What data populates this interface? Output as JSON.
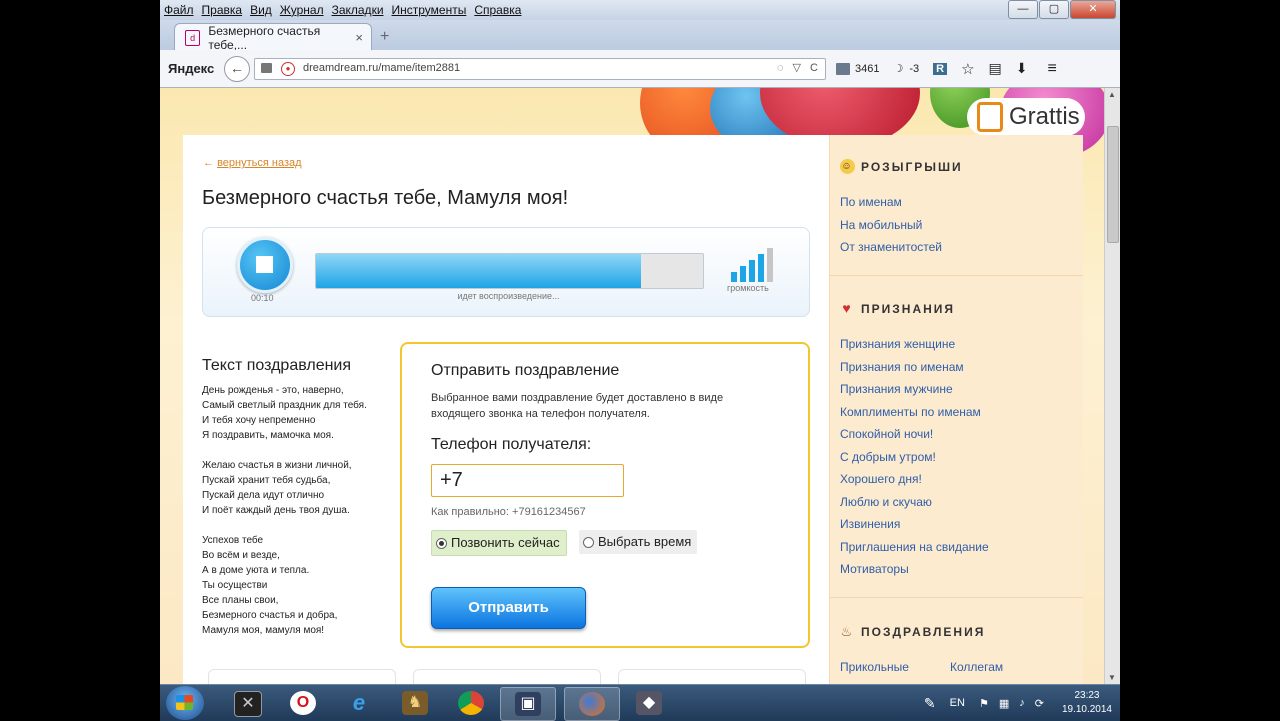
{
  "menu": [
    "Файл",
    "Правка",
    "Вид",
    "Журнал",
    "Закладки",
    "Инструменты",
    "Справка"
  ],
  "window_controls": {
    "minimize": "—",
    "maximize": "▢",
    "close": "✕"
  },
  "tab": {
    "title": "Безмерного счастья тебе,...",
    "close": "×",
    "new": "+"
  },
  "nav": {
    "yandex_label": "Яндекс",
    "back": "←",
    "url": "dreamdream.ru/mame/item2881",
    "url_icons": "◌ ▽ C",
    "mail_count": "3461",
    "weather": "-3",
    "badge": "R"
  },
  "brand": {
    "name": "Grattis"
  },
  "main": {
    "back_link": "вернуться назад",
    "back_arrow": "←",
    "title": "Безмерного счастья тебе, Мамуля моя!",
    "player": {
      "time": "00:10",
      "status": "идет воспроизведение...",
      "volume_label": "громкость",
      "progress": 0.84
    },
    "text_heading": "Текст поздравления",
    "poem": [
      "День рожденья - это, наверно,",
      "Самый светлый праздник для тебя.",
      "И тебя хочу непременно",
      "Я поздравить, мамочка моя.",
      "",
      "Желаю счастья в жизни личной,",
      "Пускай хранит тебя судьба,",
      "Пускай дела идут отлично",
      "И поёт каждый день твоя душа.",
      "",
      "Успехов тебе",
      "Во всём и везде,",
      "А в доме уюта и тепла.",
      "Ты осуществи",
      "Все планы свои,",
      "Безмерного счастья и добра,",
      "Мамуля моя, мамуля моя!"
    ],
    "send": {
      "title": "Отправить поздравление",
      "description": "Выбранное вами поздравление будет доставлено в виде входящего звонка на телефон получателя.",
      "phone_label": "Телефон получателя:",
      "phone_value": "+7",
      "hint": "Как правильно: +79161234567",
      "option_now": "Позвонить сейчас",
      "option_time": "Выбрать время",
      "button": "Отправить"
    }
  },
  "sidebar": {
    "sections": [
      {
        "title": "РОЗЫГРЫШИ",
        "links": [
          "По именам",
          "На мобильный",
          "От знаменитостей"
        ]
      },
      {
        "title": "ПРИЗНАНИЯ",
        "links": [
          "Признания женщине",
          "Признания по именам",
          "Признания мужчине",
          "Комплименты по именам",
          "Спокойной ночи!",
          "С добрым утром!",
          "Хорошего дня!",
          "Люблю и скучаю",
          "Извинения",
          "Приглашения на свидание",
          "Мотиваторы"
        ]
      },
      {
        "title": "ПОЗДРАВЛЕНИЯ",
        "links": [
          "Прикольные",
          "Коллегам"
        ]
      }
    ]
  },
  "taskbar": {
    "lang": "EN",
    "time": "23:23",
    "date": "19.10.2014"
  },
  "colors": {
    "accent_blue": "#1ea5e6",
    "link": "#2f5ea8",
    "highlight_border": "#f2c531",
    "orange": "#d6852a"
  }
}
